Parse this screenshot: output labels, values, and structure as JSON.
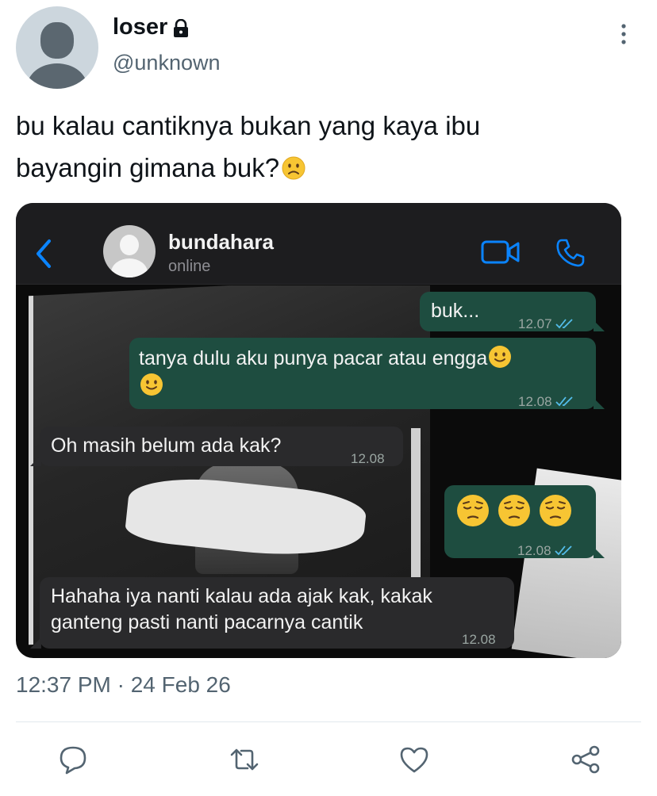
{
  "author": {
    "display_name": "loser",
    "handle": "@unknown",
    "protected": true
  },
  "tweet": {
    "text_line1": "bu kalau cantiknya bukan yang kaya ibu",
    "text_line2": "bayangin gimana buk?",
    "text_emoji": "slightly-frowning-face",
    "timestamp": "12:37 PM · 24 Feb 26"
  },
  "chat": {
    "contact_name": "bundahara",
    "contact_status": "online",
    "messages": [
      {
        "direction": "out",
        "text": "buk...",
        "time": "12.07",
        "read": true
      },
      {
        "direction": "out",
        "text": "tanya dulu aku punya pacar atau engga",
        "emojis": [
          "slightly-smiling-face",
          "slightly-smiling-face"
        ],
        "time": "12.08",
        "read": true
      },
      {
        "direction": "in",
        "text": "Oh masih belum ada kak?",
        "time": "12.08"
      },
      {
        "direction": "out",
        "text": "",
        "emojis": [
          "pensive-face",
          "pensive-face",
          "pensive-face"
        ],
        "time": "12.08",
        "read": true
      },
      {
        "direction": "in",
        "text_line1": "Hahaha iya nanti kalau ada ajak kak, kakak",
        "text_line2": "ganteng pasti nanti pacarnya cantik",
        "time": "12.08"
      }
    ]
  },
  "colors": {
    "outgoing_bubble": "#1e4d40",
    "incoming_bubble": "#2a2a2c",
    "accent_blue": "#0a84ff",
    "secondary_text": "#536471"
  },
  "icons": {
    "more": "more-vertical-icon",
    "lock": "lock-icon",
    "back": "chevron-left-icon",
    "video": "video-call-icon",
    "phone": "phone-call-icon",
    "reply": "reply-icon",
    "retweet": "retweet-icon",
    "like": "heart-icon",
    "share": "share-icon"
  }
}
